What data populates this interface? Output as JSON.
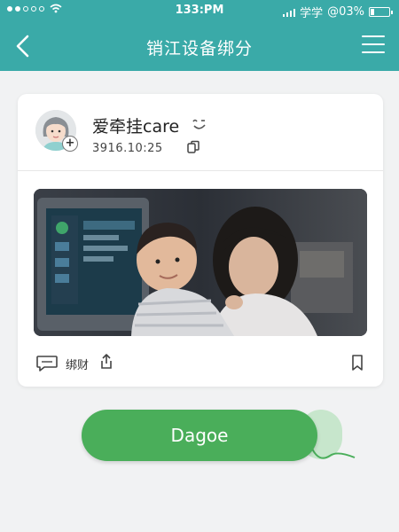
{
  "status_bar": {
    "time": "133:PM",
    "carrier": "学学",
    "battery": "@03%"
  },
  "nav": {
    "title": "销江设备绑分",
    "back_icon": "chevron-left-icon",
    "menu_icon": "hamburger-menu-icon"
  },
  "post": {
    "username": "爱牵挂care",
    "timestamp": "3916.10:25",
    "footer_label": "绑财",
    "photo_description_icon": "photo-image"
  },
  "action": {
    "button_label": "Dagoe"
  },
  "colors": {
    "header": "#3aaaa8",
    "button": "#4aae5a",
    "background": "#f1f2f3"
  }
}
